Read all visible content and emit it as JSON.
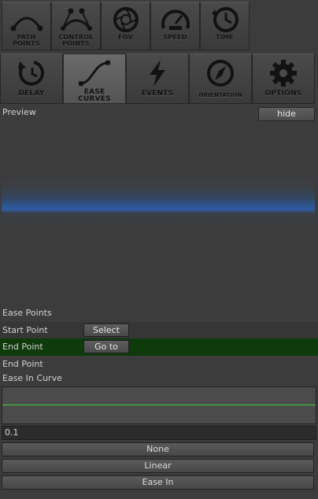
{
  "toolbar_top": [
    {
      "label1": "PATH",
      "label2": "POINTS",
      "icon": "path-points-icon"
    },
    {
      "label1": "CONTROL",
      "label2": "POINTS",
      "icon": "control-points-icon"
    },
    {
      "label1": "FOV",
      "label2": "",
      "icon": "aperture-icon"
    },
    {
      "label1": "SPEED",
      "label2": "",
      "icon": "speedometer-icon"
    },
    {
      "label1": "TIME",
      "label2": "",
      "icon": "clock-icon"
    }
  ],
  "toolbar_bottom": [
    {
      "label1": "DELAY",
      "label2": "",
      "icon": "delay-icon"
    },
    {
      "label1": "EASE",
      "label2": "CURVES",
      "icon": "ease-curve-icon",
      "active": true
    },
    {
      "label1": "EVENTS",
      "label2": "",
      "icon": "lightning-icon"
    },
    {
      "label1": "ORIENTATION",
      "label2": "",
      "icon": "compass-icon"
    },
    {
      "label1": "OPTIONS",
      "label2": "",
      "icon": "gear-icon"
    }
  ],
  "preview": {
    "label": "Preview",
    "hide_button": "hide"
  },
  "ease_points": {
    "heading": "Ease Points",
    "start_label": "Start Point",
    "select_button": "Select",
    "end_label": "End Point",
    "goto_button": "Go to",
    "end_label2": "End Point"
  },
  "ease_in_curve": {
    "label": "Ease In Curve",
    "value": "0.1",
    "curve_color": "#3fd23a"
  },
  "curve_buttons": [
    "None",
    "Linear",
    "Ease In"
  ],
  "colors": {
    "background": "#3c3c3c",
    "highlight_row": "#0e3a0c",
    "preview_band": "#2c5596"
  }
}
